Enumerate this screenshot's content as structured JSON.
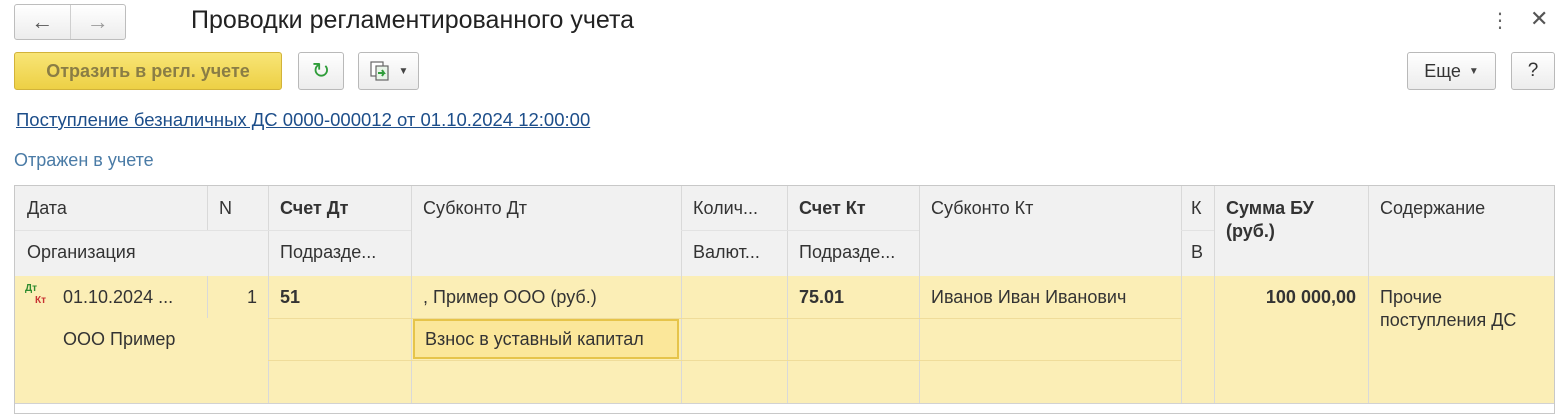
{
  "window": {
    "title": "Проводки регламентированного учета",
    "nav_back_icon": "arrow-left-icon",
    "nav_forward_icon": "arrow-right-icon",
    "more_icon": "kebab-icon",
    "close_icon": "close-icon"
  },
  "toolbar": {
    "post_label": "Отразить в регл. учете",
    "refresh_icon": "refresh-icon",
    "structure_icon": "document-structure-icon",
    "more_label": "Еще",
    "help_label": "?"
  },
  "document_link": "Поступление безналичных ДС 0000-000012 от 01.10.2024 12:00:00",
  "status_text": "Отражен в учете",
  "columns": {
    "date": "Дата",
    "n": "N",
    "organization": "Организация",
    "account_dt": "Счет Дт",
    "division_dt": "Подразде...",
    "subconto_dt": "Субконто Дт",
    "quantity": "Колич...",
    "currency": "Валют...",
    "account_kt": "Счет Кт",
    "division_kt": "Подразде...",
    "subconto_kt": "Субконто Кт",
    "k": "К",
    "v": "В",
    "amount_line1": "Сумма БУ",
    "amount_line2": "(руб.)",
    "content": "Содержание"
  },
  "rows": [
    {
      "icon": "dt-kt-icon",
      "icon_dt": "Дт",
      "icon_kt": "Кт",
      "date": "01.10.2024 ...",
      "n": "1",
      "organization": "ООО Пример",
      "account_dt": "51",
      "subconto_dt1": ", Пример ООО (руб.)",
      "subconto_dt2": "Взнос в уставный капитал",
      "account_kt": "75.01",
      "subconto_kt1": "Иванов Иван Иванович",
      "amount": "100 000,00",
      "content_line1": "Прочие",
      "content_line2": "поступления ДС"
    }
  ],
  "colors": {
    "primary_button": "#edd045",
    "row_highlight": "#fbeeb6",
    "link": "#1d4e8a",
    "status": "#4a7ba6"
  }
}
